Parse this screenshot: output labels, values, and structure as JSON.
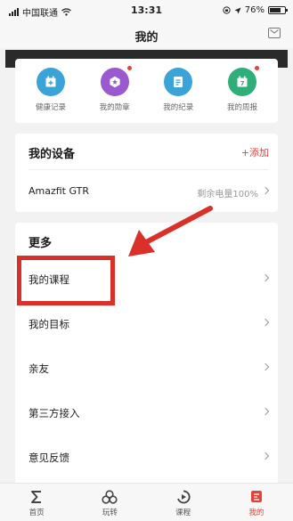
{
  "status_bar": {
    "carrier": "中国联通",
    "time": "13:31",
    "battery": "76%",
    "battery_level": 0.76
  },
  "nav": {
    "title": "我的",
    "mail_icon": "mail-icon"
  },
  "quick_actions": [
    {
      "label": "健康记录",
      "icon": "calendar-plus-icon",
      "color": "#3aa3d8",
      "badge": false
    },
    {
      "label": "我的勋章",
      "icon": "medal-icon",
      "color": "#9b59d0",
      "badge": true
    },
    {
      "label": "我的纪录",
      "icon": "record-icon",
      "color": "#3aa3d8",
      "badge": false
    },
    {
      "label": "我的周报",
      "icon": "calendar-7-icon",
      "color": "#2fae7a",
      "badge": true,
      "icon_text": "7"
    }
  ],
  "devices": {
    "title": "我的设备",
    "add_label": "+添加",
    "device_name": "Amazfit GTR",
    "battery_text": "剩余电量100%"
  },
  "more": {
    "title": "更多",
    "items": [
      "我的课程",
      "我的目标",
      "亲友",
      "第三方接入",
      "意见反馈"
    ]
  },
  "tabs": [
    {
      "label": "首页",
      "icon": "sigma-icon",
      "active": false
    },
    {
      "label": "玩转",
      "icon": "rings-icon",
      "active": false
    },
    {
      "label": "课程",
      "icon": "play-icon",
      "active": false
    },
    {
      "label": "我的",
      "icon": "profile-icon",
      "active": true
    }
  ],
  "colors": {
    "accent": "#e8413a",
    "annotation": "#d9302a"
  }
}
